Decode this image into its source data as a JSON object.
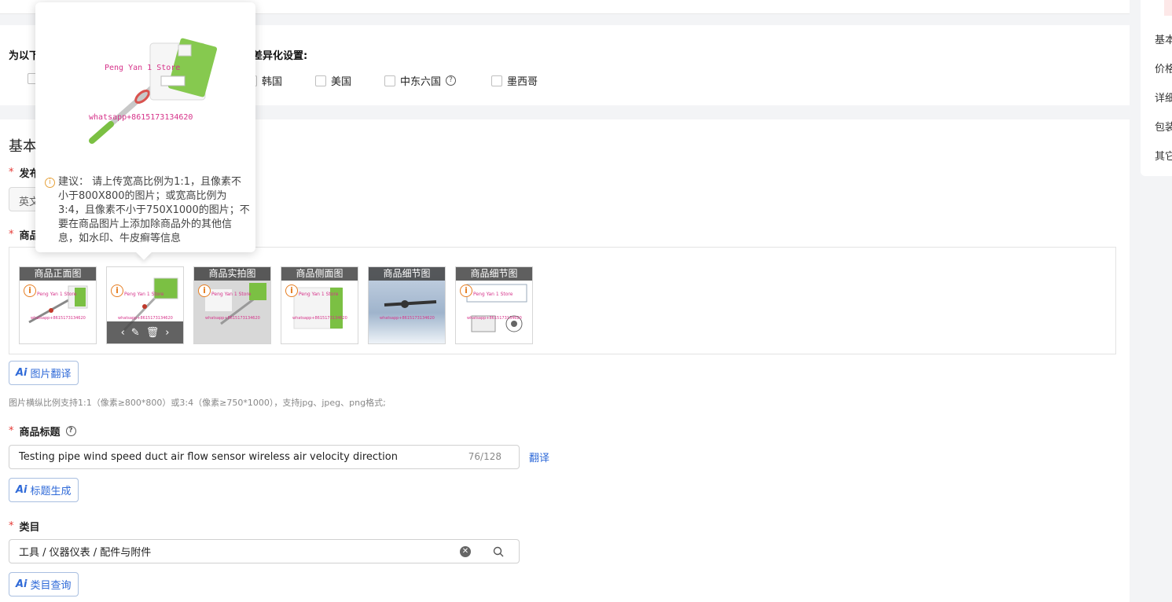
{
  "region_settings": {
    "heading_start": "为以下",
    "heading_end": "的差异化设置:",
    "options": [
      {
        "label": "韩国",
        "checked": false
      },
      {
        "label": "美国",
        "checked": false
      },
      {
        "label": "中东六国",
        "checked": false,
        "has_help": true
      },
      {
        "label": "墨西哥",
        "checked": false
      }
    ]
  },
  "basic_info": {
    "section_title": "基本信息",
    "publish_language": {
      "label": "发布语言",
      "value": "英文"
    },
    "product_images": {
      "label": "商品图片",
      "thumbnails": [
        {
          "label": "商品正面图",
          "store_text": "Peng Yan 1 Store",
          "wa_text": "whatsapp+8615173134620"
        },
        {
          "label": "",
          "store_text": "Peng Yan 1 Store",
          "wa_text": "whatsapp+8615173134620",
          "hovered": true
        },
        {
          "label": "商品实拍图",
          "store_text": "Peng Yan 1 Store",
          "wa_text": "whatsapp+8615173134620"
        },
        {
          "label": "商品侧面图",
          "store_text": "Peng Yan 1 Store",
          "wa_text": "whatsapp+8615173134620"
        },
        {
          "label": "商品细节图",
          "store_text": "",
          "wa_text": "whatsapp+8615173134620"
        },
        {
          "label": "商品细节图",
          "store_text": "Peng Yan 1 Store",
          "wa_text": "whatsapp+8615173134620"
        }
      ],
      "translate_button": "图片翻译",
      "hint": "图片横纵比例支持1:1（像素≥800*800）或3:4（像素≥750*1000），支持jpg、jpeg、png格式;"
    },
    "product_title": {
      "label": "商品标题",
      "value": "Testing pipe wind speed duct air flow sensor wireless air velocity direction",
      "counter": "76/128",
      "translate_link": "翻译",
      "generate_button": "标题生成"
    },
    "category": {
      "label": "类目",
      "value": "工具 / 仪器仪表 / 配件与附件",
      "query_button": "类目查询"
    }
  },
  "right_nav": {
    "items": [
      "基本信息",
      "价格库存",
      "详细描述",
      "包装与物流",
      "其它设置"
    ]
  },
  "popover": {
    "store_text": "Peng Yan 1 Store",
    "wa_text": "whatsapp+8615173134620",
    "note": "建议： 请上传宽高比例为1:1，且像素不小于800X800的图片；或宽高比例为3:4，且像素不小于750X1000的图片；不要在商品图片上添加除商品外的其他信息，如水印、牛皮癣等信息"
  },
  "colors": {
    "accent": "#2f6ad8",
    "required": "#e53935",
    "watermark": "#d6338a",
    "warning": "#e67e22"
  }
}
